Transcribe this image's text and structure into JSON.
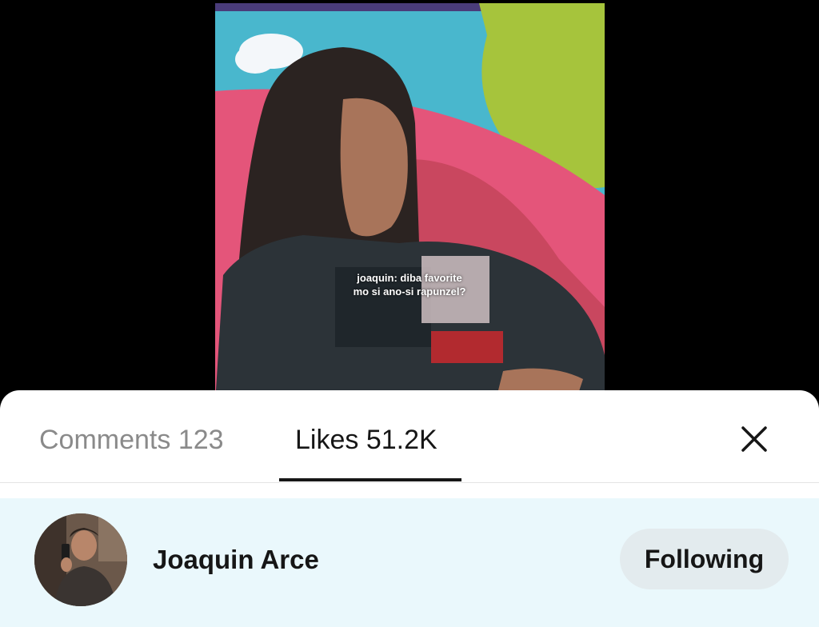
{
  "video": {
    "caption_line1": "joaquin: diba favorite",
    "caption_line2": "mo si ano-si rapunzel?"
  },
  "tabs": [
    {
      "label": "Comments 123",
      "active": false
    },
    {
      "label": "Likes 51.2K",
      "active": true
    }
  ],
  "close_icon": "close-icon",
  "likes_list": [
    {
      "name": "Joaquin Arce",
      "button_label": "Following"
    }
  ],
  "colors": {
    "sheet_background": "#ffffff",
    "highlight_row": "#eaf8fc",
    "button_background": "#e3ebee",
    "active_tab_text": "#161616",
    "inactive_tab_text": "#8a8a8a"
  }
}
